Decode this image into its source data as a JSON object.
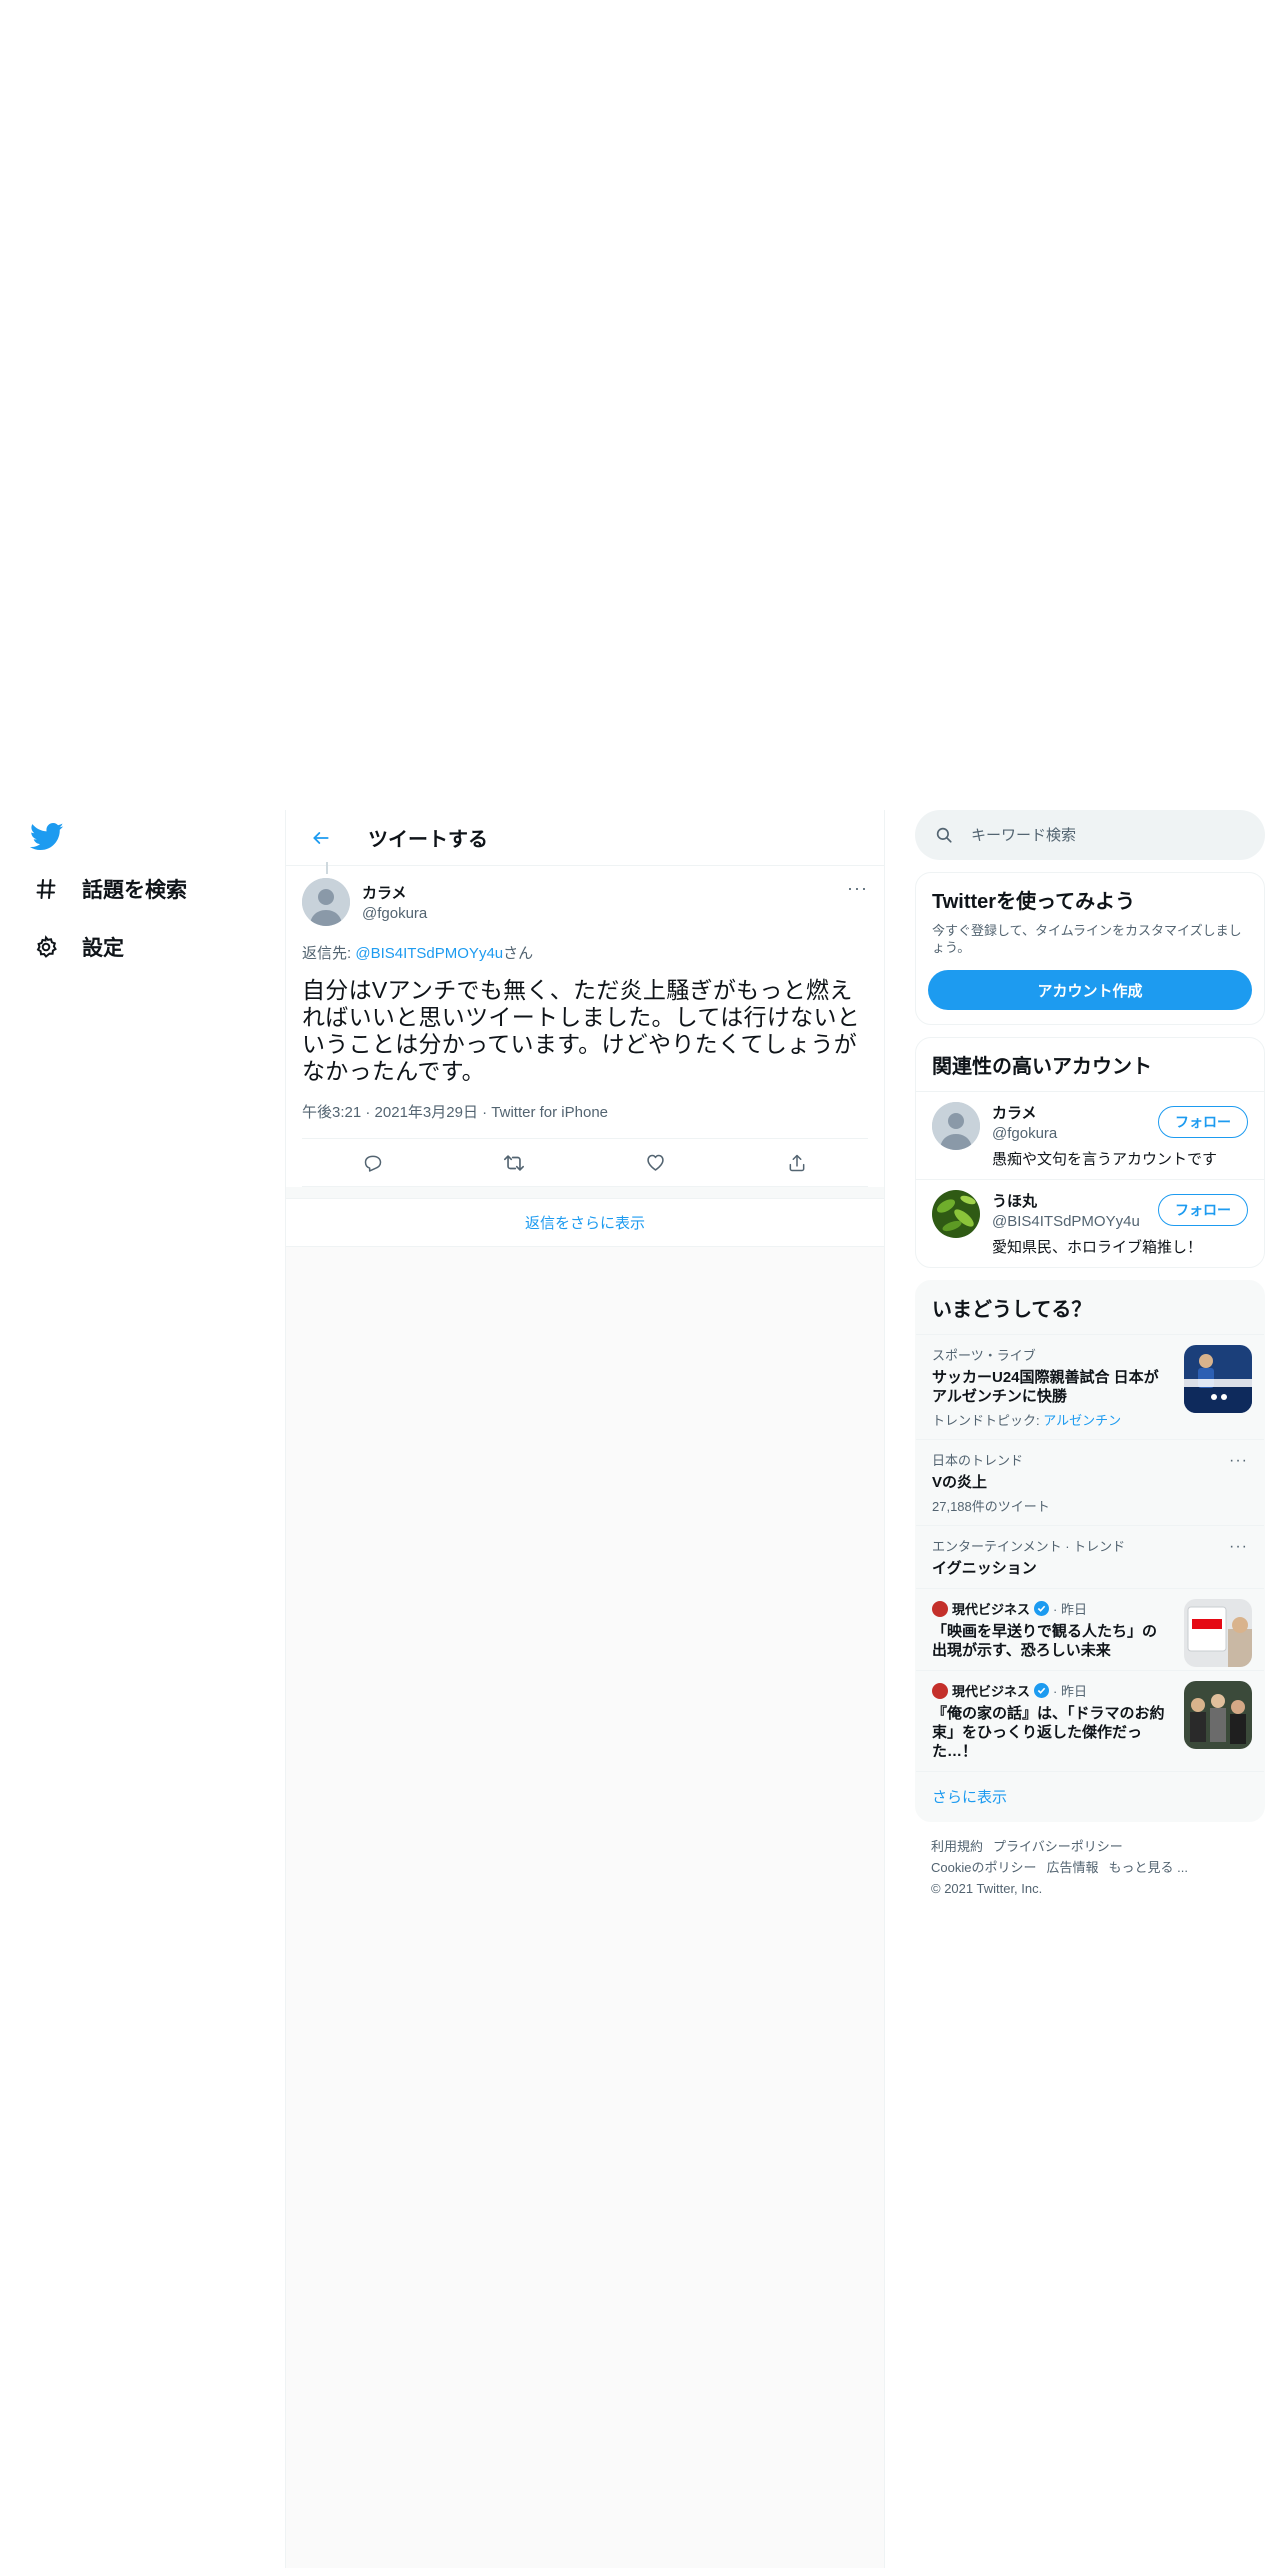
{
  "nav": {
    "explore_label": "話題を検索",
    "settings_label": "設定"
  },
  "header": {
    "title": "ツイートする"
  },
  "tweet": {
    "display_name": "カラメ",
    "handle": "@fgokura",
    "more": "···",
    "reply_prefix": "返信先: ",
    "reply_mention": "@BIS4ITSdPMOYy4u",
    "reply_suffix": "さん",
    "text": "自分はVアンチでも無く、ただ炎上騒ぎがもっと燃えればいいと思いツイートしました。しては行けないということは分かっています。けどやりたくてしょうがなかったんです。",
    "time": "午後3:21",
    "date": "2021年3月29日",
    "source": "Twitter for iPhone",
    "sep": " · "
  },
  "show_more_replies": "返信をさらに表示",
  "search": {
    "placeholder": "キーワード検索"
  },
  "signup": {
    "title": "Twitterを使ってみよう",
    "desc": "今すぐ登録して、タイムラインをカスタマイズしましょう。",
    "button": "アカウント作成"
  },
  "related": {
    "title": "関連性の高いアカウント",
    "accounts": [
      {
        "name": "カラメ",
        "handle": "@fgokura",
        "bio": "愚痴や文句を言うアカウントです",
        "follow": "フォロー"
      },
      {
        "name": "うほ丸",
        "handle": "@BIS4ITSdPMOYy4u",
        "bio": "愛知県民、ホロライブ箱推し！",
        "follow": "フォロー"
      }
    ]
  },
  "trends": {
    "title": "いまどうしてる？",
    "items": [
      {
        "category": "スポーツ・ライブ",
        "title": "サッカーU24国際親善試合 日本がアルゼンチンに快勝",
        "sub_prefix": "トレンドトピック: ",
        "sub_link": "アルゼンチン"
      },
      {
        "category": "日本のトレンド",
        "title": "Vの炎上",
        "sub": "27,188件のツイート"
      },
      {
        "category": "エンターテインメント · トレンド",
        "title": "イグニッション"
      },
      {
        "source": "現代ビジネス",
        "time": "· 昨日",
        "title": "「映画を早送りで観る人たち」の出現が示す、恐ろしい未来"
      },
      {
        "source": "現代ビジネス",
        "time": "· 昨日",
        "title": "『俺の家の話』は、「ドラマのお約束」をひっくり返した傑作だった…！"
      }
    ],
    "show_more": "さらに表示"
  },
  "footer": {
    "links": [
      "利用規約",
      "プライバシーポリシー",
      "Cookieのポリシー",
      "広告情報",
      "もっと見る ..."
    ],
    "copyright": "© 2021 Twitter, Inc."
  },
  "colors": {
    "accent": "#1d9bf0",
    "text": "#0f1419",
    "secondary": "#536471",
    "border": "#eff3f4"
  },
  "icons": [
    "twitter-bird-icon",
    "hashtag-icon",
    "gear-icon",
    "back-arrow-icon",
    "reply-icon",
    "retweet-icon",
    "like-icon",
    "share-icon",
    "search-icon",
    "verified-icon"
  ]
}
